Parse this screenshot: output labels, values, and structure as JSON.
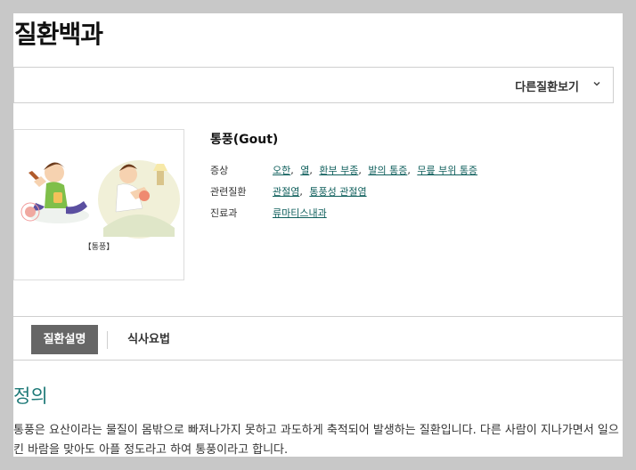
{
  "page": {
    "title": "질환백과"
  },
  "selector": {
    "label": "다른질환보기",
    "icon": "chevron-down-icon"
  },
  "disease": {
    "image_caption": "【통풍】",
    "title": "통풍(Gout)",
    "rows": [
      {
        "label": "증상",
        "values": [
          "오한",
          "열",
          "환부 부종",
          "발의 통증",
          "무릎 부위 통증"
        ]
      },
      {
        "label": "관련질환",
        "values": [
          "관절염",
          "통풍성 관절염"
        ]
      },
      {
        "label": "진료과",
        "values": [
          "류마티스내과"
        ]
      }
    ]
  },
  "tabs": [
    {
      "label": "질환설명",
      "active": true
    },
    {
      "label": "식사요법",
      "active": false
    }
  ],
  "section": {
    "heading": "정의",
    "body": "통풍은 요산이라는 물질이 몸밖으로 빠져나가지 못하고 과도하게 축적되어 발생하는 질환입니다. 다른 사람이 지나가면서 일으킨 바람을 맞아도 아플 정도라고 하여 통풍이라고 합니다."
  },
  "colors": {
    "accent": "#1f7a78",
    "link": "#0f5f5c",
    "active_tab": "#666666",
    "frame": "#c8c8c8"
  }
}
